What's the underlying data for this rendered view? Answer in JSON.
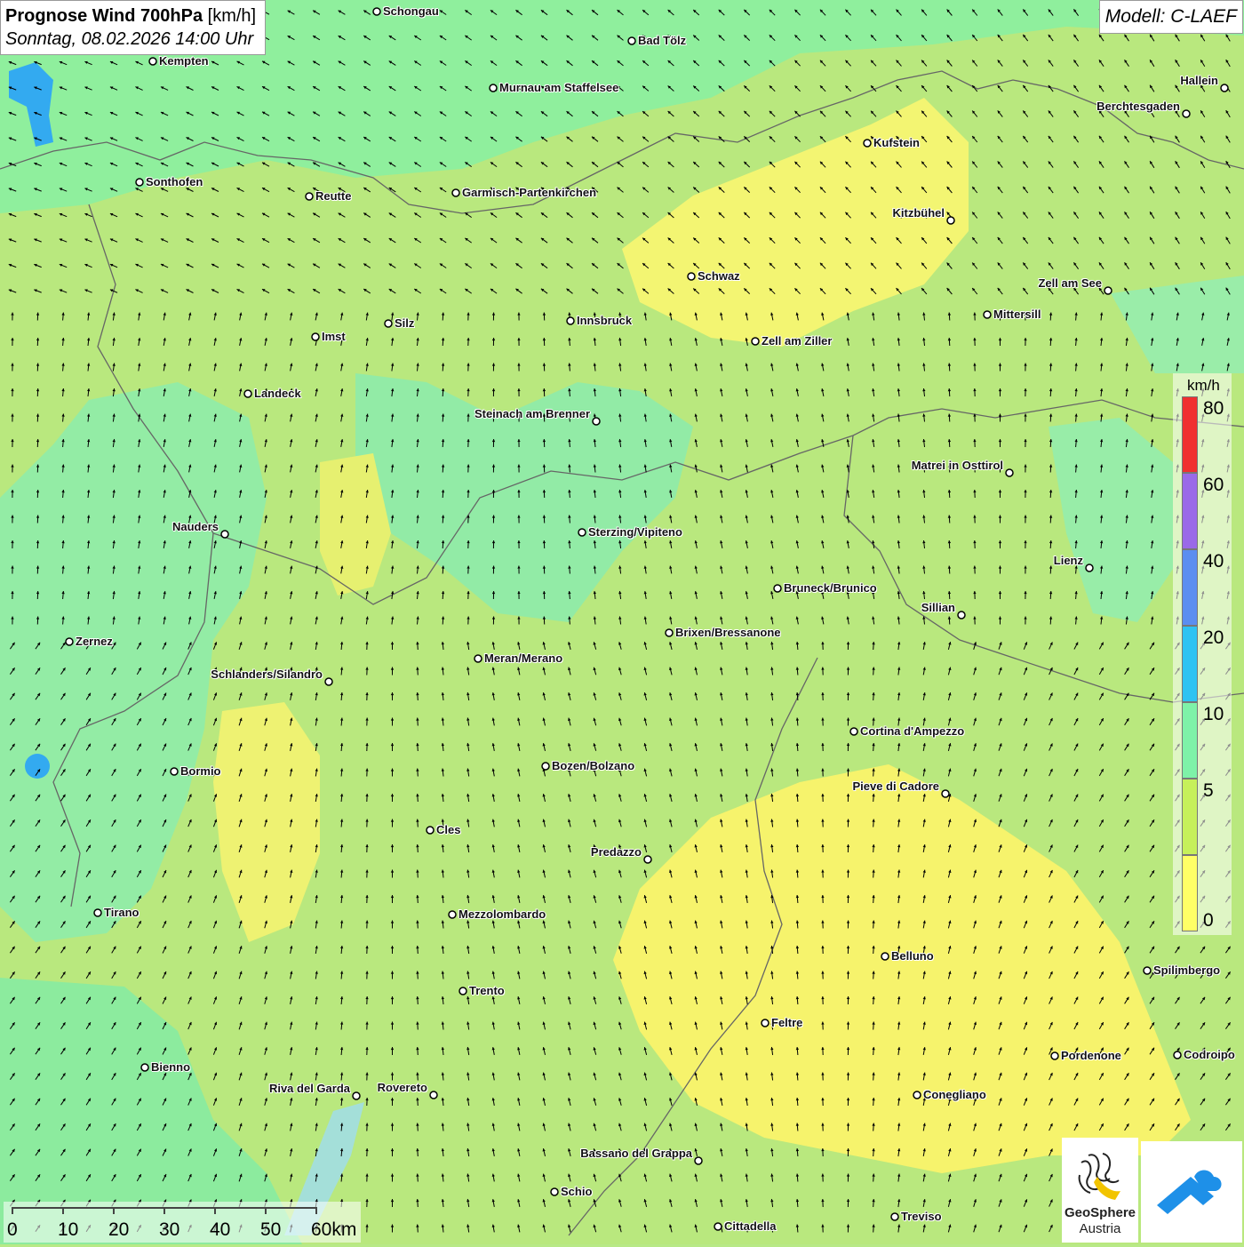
{
  "header": {
    "title_bold": "Prognose Wind 700hPa",
    "title_unit": "[km/h]",
    "datetime": "Sonntag, 08.02.2026 14:00 Uhr",
    "model": "Modell: C-LAEF"
  },
  "legend": {
    "unit": "km/h",
    "classes": [
      {
        "label": "0",
        "color": "#ffff66"
      },
      {
        "label": "5",
        "color": "#c6f05a"
      },
      {
        "label": "10",
        "color": "#7ef2a8"
      },
      {
        "label": "20",
        "color": "#2ec3f2"
      },
      {
        "label": "40",
        "color": "#5b8ef0"
      },
      {
        "label": "60",
        "color": "#9a6ae8"
      },
      {
        "label": "80",
        "color": "#f03030"
      }
    ]
  },
  "scalebar": {
    "labels": [
      "0",
      "10",
      "20",
      "30",
      "40",
      "50",
      "60km"
    ]
  },
  "logos": {
    "geosphere_line1": "GeoSphere",
    "geosphere_line2": "Austria"
  },
  "cities": [
    {
      "name": "Schongau"
    },
    {
      "name": "Kempten"
    },
    {
      "name": "Bad Tölz"
    },
    {
      "name": "Murnau am Staffelsee"
    },
    {
      "name": "Hallein"
    },
    {
      "name": "Berchtesgaden"
    },
    {
      "name": "Kufstein"
    },
    {
      "name": "Sonthofen"
    },
    {
      "name": "Reutte"
    },
    {
      "name": "Garmisch-Partenkirchen"
    },
    {
      "name": "Kitzbühel"
    },
    {
      "name": "Schwaz"
    },
    {
      "name": "Zell am See"
    },
    {
      "name": "Mittersill"
    },
    {
      "name": "Silz"
    },
    {
      "name": "Innsbruck"
    },
    {
      "name": "Imst"
    },
    {
      "name": "Zell am Ziller"
    },
    {
      "name": "Landeck"
    },
    {
      "name": "Steinach am Brenner"
    },
    {
      "name": "Matrei in Osttirol"
    },
    {
      "name": "Nauders"
    },
    {
      "name": "Sterzing/Vipiteno"
    },
    {
      "name": "Lienz"
    },
    {
      "name": "Bruneck/Brunico"
    },
    {
      "name": "Sillian"
    },
    {
      "name": "Zernez"
    },
    {
      "name": "Brixen/Bressanone"
    },
    {
      "name": "Meran/Merano"
    },
    {
      "name": "Schlanders/Silandro"
    },
    {
      "name": "Cortina d'Ampezzo"
    },
    {
      "name": "Bozen/Bolzano"
    },
    {
      "name": "Bormio"
    },
    {
      "name": "Pieve di Cadore"
    },
    {
      "name": "Cles"
    },
    {
      "name": "Predazzo"
    },
    {
      "name": "Tirano"
    },
    {
      "name": "Mezzolombardo"
    },
    {
      "name": "Belluno"
    },
    {
      "name": "Spilimbergo"
    },
    {
      "name": "Trento"
    },
    {
      "name": "Feltre"
    },
    {
      "name": "Pordenone"
    },
    {
      "name": "Codroipo"
    },
    {
      "name": "Bienno"
    },
    {
      "name": "Riva del Garda"
    },
    {
      "name": "Rovereto"
    },
    {
      "name": "Conegliano"
    },
    {
      "name": "Bassano del Grappa"
    },
    {
      "name": "Schio"
    },
    {
      "name": "Treviso"
    },
    {
      "name": "Cittadella"
    }
  ]
}
